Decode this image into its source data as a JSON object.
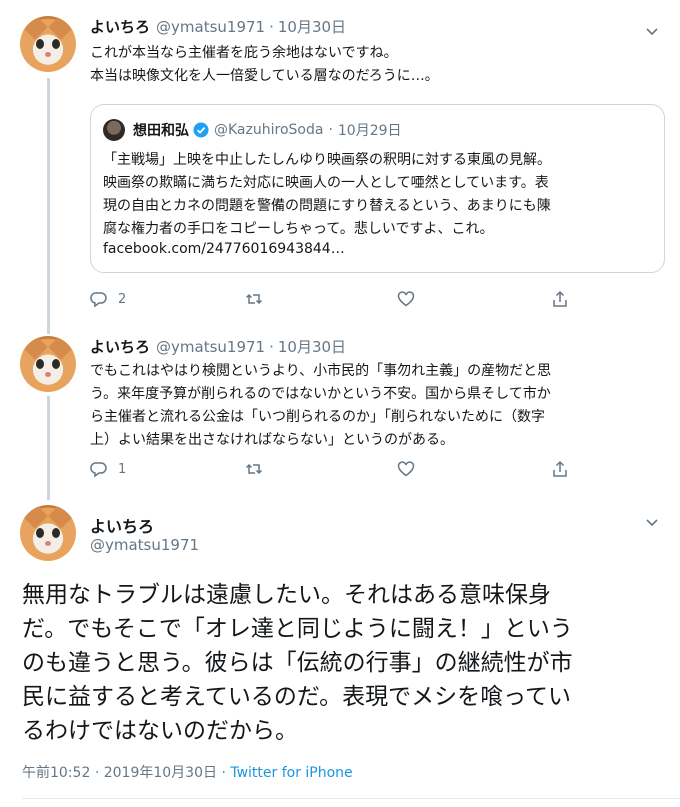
{
  "tweets": [
    {
      "display_name": "よいちろ",
      "handle": "@ymatsu1971",
      "separator": "·",
      "date": "10月30日",
      "text": "これが本当なら主催者を庇う余地はないですね。\n本当は映像文化を人一倍愛している層なのだろうに…。",
      "quote": {
        "display_name": "想田和弘",
        "verified_icon": "verified-badge-icon",
        "handle": "@KazuhiroSoda",
        "separator": "·",
        "date": "10月29日",
        "text": "「主戦場」上映を中止したしんゆり映画祭の釈明に対する東風の見解。\n映画祭の欺瞞に満ちた対応に映画人の一人として唖然としています。表\n現の自由とカネの問題を警備の問題にすり替えるという、あまりにも陳\n腐な権力者の手口をコピーしちゃって。悲しいですよ、これ。",
        "link": "facebook.com/24776016943844…"
      },
      "reply_count": "2",
      "retweet_count": "",
      "like_count": ""
    },
    {
      "display_name": "よいちろ",
      "handle": "@ymatsu1971",
      "separator": "·",
      "date": "10月30日",
      "text": "でもこれはやはり検閲というより、小市民的「事勿れ主義」の産物だと思\nう。来年度予算が削られるのではないかという不安。国から県そして市か\nら主催者と流れる公金は「いつ削られるのか」「削られないために（数字\n上）よい結果を出さなければならない」というのがある。",
      "reply_count": "1",
      "retweet_count": "",
      "like_count": ""
    }
  ],
  "main_tweet": {
    "display_name": "よいちろ",
    "handle": "@ymatsu1971",
    "text": "無用なトラブルは遠慮したい。それはある意味保身\nだ。でもそこで「オレ達と同じように闘え！」という\nのも違うと思う。彼らは「伝統の行事」の継続性が市\n民に益すると考えているのだ。表現でメシを喰ってい\nるわけではないのだから。",
    "time": "午前10:52",
    "separator": "·",
    "date": "2019年10月30日",
    "source_separator": "·",
    "source": "Twitter for iPhone"
  },
  "colors": {
    "text": "#14171a",
    "muted": "#657786",
    "link": "#1b95e0",
    "border": "#ccd6dd",
    "verified": "#1da1f2"
  },
  "icons": {
    "reply": "reply-icon",
    "retweet": "retweet-icon",
    "like": "heart-icon",
    "share": "share-icon",
    "more": "chevron-down-icon"
  }
}
